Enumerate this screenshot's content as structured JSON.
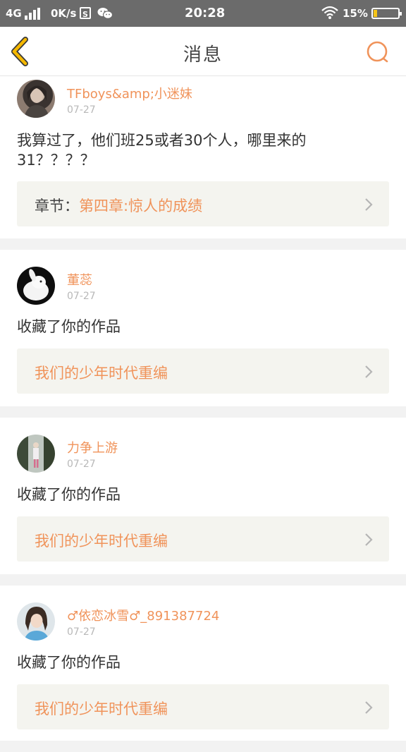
{
  "status_bar": {
    "network": "4G",
    "speed": "0K/s",
    "s_icon": "S",
    "time": "20:28",
    "battery": "15%",
    "colors": {
      "background": "#6b6b6b",
      "battery_fill": "#f5c518"
    }
  },
  "header": {
    "title": "消息",
    "back_icon": "chevron-left-icon",
    "search_icon": "search-icon",
    "accent": "#f0935a",
    "back_color": "#f5b800"
  },
  "messages": [
    {
      "user": "TFboys&amp;小迷妹",
      "date": "07-27",
      "text": "我算过了，他们班25或者30个人，哪里来的31？？？？",
      "link_prefix": "章节：",
      "link_text": "第四章:惊人的成绩"
    },
    {
      "user": "董蕊",
      "date": "07-27",
      "text": "收藏了你的作品",
      "link_prefix": "",
      "link_text": "我们的少年时代重编"
    },
    {
      "user": "力争上游",
      "date": "07-27",
      "text": "收藏了你的作品",
      "link_prefix": "",
      "link_text": "我们的少年时代重编"
    },
    {
      "user": "♂依恋冰雪♂_891387724",
      "date": "07-27",
      "text": "收藏了你的作品",
      "link_prefix": "",
      "link_text": "我们的少年时代重编"
    }
  ]
}
